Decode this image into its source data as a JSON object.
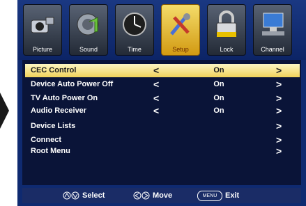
{
  "tabs": [
    {
      "label": "Picture",
      "icon": "camcorder-icon"
    },
    {
      "label": "Sound",
      "icon": "speaker-icon"
    },
    {
      "label": "Time",
      "icon": "clock-icon"
    },
    {
      "label": "Setup",
      "icon": "tools-icon"
    },
    {
      "label": "Lock",
      "icon": "padlock-icon"
    },
    {
      "label": "Channel",
      "icon": "computer-icon"
    }
  ],
  "active_tab": "Setup",
  "rows": [
    {
      "label": "CEC Control",
      "value": "On"
    },
    {
      "label": "Device Auto Power Off",
      "value": "On"
    },
    {
      "label": "TV Auto Power On",
      "value": "On"
    },
    {
      "label": "Audio Receiver",
      "value": "On"
    },
    {
      "label": "Device Lists",
      "value": ""
    },
    {
      "label": "Connect",
      "value": ""
    },
    {
      "label": "Root Menu",
      "value": ""
    }
  ],
  "arrows": {
    "left": "<",
    "right": ">"
  },
  "footer": {
    "select": "Select",
    "move": "Move",
    "menu_key": "MENU",
    "exit": "Exit"
  },
  "colors": {
    "highlight": "#f0d25a",
    "background": "#0f2a70"
  }
}
